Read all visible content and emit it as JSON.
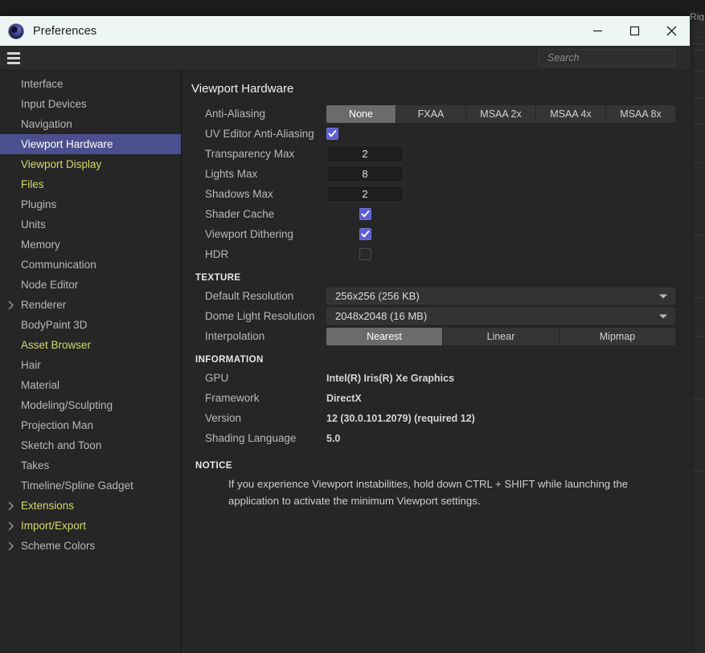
{
  "background_app": {
    "right_edge_label": "Rig"
  },
  "titlebar": {
    "title": "Preferences",
    "icon": "cinema4d-app-icon",
    "minimize_label": "Minimize",
    "maximize_label": "Maximize",
    "close_label": "Close"
  },
  "toolbar": {
    "menu_icon": "hamburger-menu-icon",
    "search_placeholder": "Search",
    "search_value": ""
  },
  "sidebar": {
    "items": [
      {
        "label": "Interface",
        "expandable": false,
        "accent": false,
        "selected": false
      },
      {
        "label": "Input Devices",
        "expandable": false,
        "accent": false,
        "selected": false
      },
      {
        "label": "Navigation",
        "expandable": false,
        "accent": false,
        "selected": false
      },
      {
        "label": "Viewport Hardware",
        "expandable": false,
        "accent": false,
        "selected": true
      },
      {
        "label": "Viewport Display",
        "expandable": false,
        "accent": true,
        "selected": false
      },
      {
        "label": "Files",
        "expandable": false,
        "accent": true,
        "selected": false
      },
      {
        "label": "Plugins",
        "expandable": false,
        "accent": false,
        "selected": false
      },
      {
        "label": "Units",
        "expandable": false,
        "accent": false,
        "selected": false
      },
      {
        "label": "Memory",
        "expandable": false,
        "accent": false,
        "selected": false
      },
      {
        "label": "Communication",
        "expandable": false,
        "accent": false,
        "selected": false
      },
      {
        "label": "Node Editor",
        "expandable": false,
        "accent": false,
        "selected": false
      },
      {
        "label": "Renderer",
        "expandable": true,
        "accent": false,
        "selected": false
      },
      {
        "label": "BodyPaint 3D",
        "expandable": false,
        "accent": false,
        "selected": false
      },
      {
        "label": "Asset Browser",
        "expandable": false,
        "accent": true,
        "selected": false
      },
      {
        "label": "Hair",
        "expandable": false,
        "accent": false,
        "selected": false
      },
      {
        "label": "Material",
        "expandable": false,
        "accent": false,
        "selected": false
      },
      {
        "label": "Modeling/Sculpting",
        "expandable": false,
        "accent": false,
        "selected": false
      },
      {
        "label": "Projection Man",
        "expandable": false,
        "accent": false,
        "selected": false
      },
      {
        "label": "Sketch and Toon",
        "expandable": false,
        "accent": false,
        "selected": false
      },
      {
        "label": "Takes",
        "expandable": false,
        "accent": false,
        "selected": false
      },
      {
        "label": "Timeline/Spline Gadget",
        "expandable": false,
        "accent": false,
        "selected": false
      },
      {
        "label": "Extensions",
        "expandable": true,
        "accent": true,
        "selected": false
      },
      {
        "label": "Import/Export",
        "expandable": true,
        "accent": true,
        "selected": false
      },
      {
        "label": "Scheme Colors",
        "expandable": true,
        "accent": false,
        "selected": false
      }
    ]
  },
  "main": {
    "title": "Viewport Hardware",
    "anti_aliasing": {
      "label": "Anti-Aliasing",
      "options": [
        "None",
        "FXAA",
        "MSAA 2x",
        "MSAA 4x",
        "MSAA 8x"
      ],
      "selected": "None"
    },
    "uv_editor_anti_aliasing": {
      "label": "UV Editor Anti-Aliasing",
      "checked": true
    },
    "transparency_max": {
      "label": "Transparency Max",
      "value": "2"
    },
    "lights_max": {
      "label": "Lights Max",
      "value": "8"
    },
    "shadows_max": {
      "label": "Shadows Max",
      "value": "2"
    },
    "shader_cache": {
      "label": "Shader Cache",
      "checked": true
    },
    "viewport_dithering": {
      "label": "Viewport Dithering",
      "checked": true
    },
    "hdr": {
      "label": "HDR",
      "checked": false
    },
    "texture": {
      "heading": "TEXTURE",
      "default_resolution": {
        "label": "Default Resolution",
        "value": "256x256 (256 KB)"
      },
      "dome_light_resolution": {
        "label": "Dome Light Resolution",
        "value": "2048x2048 (16 MB)"
      },
      "interpolation": {
        "label": "Interpolation",
        "options": [
          "Nearest",
          "Linear",
          "Mipmap"
        ],
        "selected": "Nearest"
      }
    },
    "information": {
      "heading": "INFORMATION",
      "rows": [
        {
          "label": "GPU",
          "value": "Intel(R) Iris(R) Xe Graphics"
        },
        {
          "label": "Framework",
          "value": "DirectX"
        },
        {
          "label": "Version",
          "value": "12 (30.0.101.2079) (required 12)"
        },
        {
          "label": "Shading Language",
          "value": "5.0"
        }
      ]
    },
    "notice": {
      "heading": "NOTICE",
      "text": "If you experience Viewport instabilities, hold down CTRL + SHIFT while launching the application to activate the minimum Viewport settings."
    }
  },
  "colors": {
    "dialog_bg": "#262626",
    "titlebar_bg": "#eef5f5",
    "selected_nav": "#4c4f8e",
    "accent_nav_text": "#d2d96a",
    "checkbox_on": "#5d5fcf",
    "segment_active": "#6b6b6b"
  }
}
